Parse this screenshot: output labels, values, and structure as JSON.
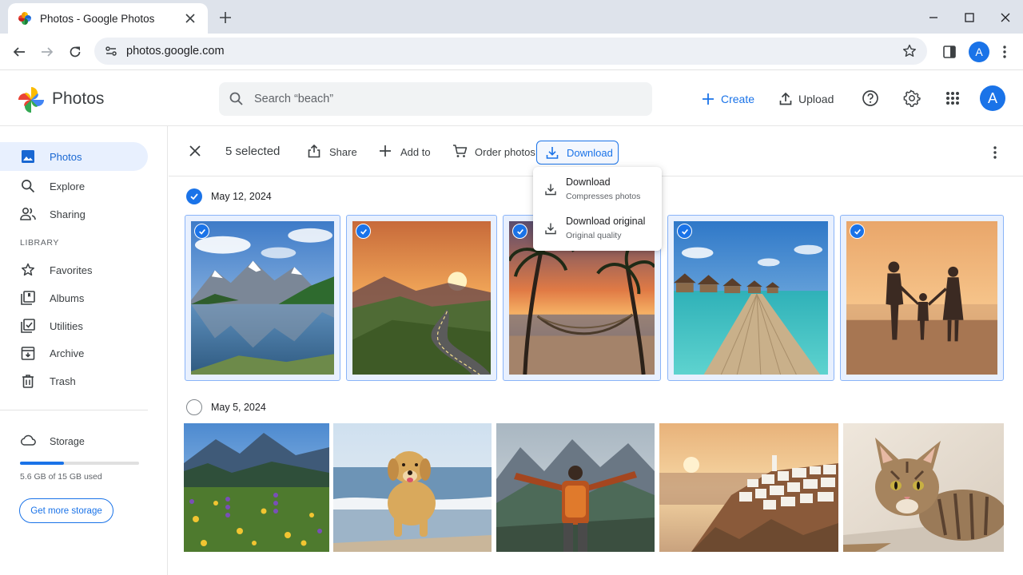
{
  "browser": {
    "tab_title": "Photos - Google Photos",
    "url": "photos.google.com",
    "profile_initial": "A"
  },
  "header": {
    "brand": "Photos",
    "search_placeholder": "Search “beach”",
    "create_label": "Create",
    "upload_label": "Upload",
    "avatar_initial": "A"
  },
  "sidebar": {
    "items": [
      {
        "label": "Photos",
        "icon": "photos-icon",
        "active": true
      },
      {
        "label": "Explore",
        "icon": "search-icon"
      },
      {
        "label": "Sharing",
        "icon": "people-icon"
      }
    ],
    "library_label": "LIBRARY",
    "library_items": [
      {
        "label": "Favorites",
        "icon": "star-icon"
      },
      {
        "label": "Albums",
        "icon": "albums-icon"
      },
      {
        "label": "Utilities",
        "icon": "utilities-icon"
      },
      {
        "label": "Archive",
        "icon": "archive-icon"
      },
      {
        "label": "Trash",
        "icon": "trash-icon"
      }
    ],
    "storage_label": "Storage",
    "storage_used_text": "5.6 GB of 15 GB used",
    "storage_fraction": 0.37,
    "get_more_label": "Get more storage"
  },
  "selection": {
    "count_text": "5 selected",
    "share_label": "Share",
    "add_to_label": "Add to",
    "order_label": "Order photos",
    "download_label": "Download"
  },
  "download_menu": [
    {
      "title": "Download",
      "subtitle": "Compresses photos"
    },
    {
      "title": "Download original",
      "subtitle": "Original quality"
    }
  ],
  "groups": [
    {
      "date": "May 12, 2024",
      "selected": true
    },
    {
      "date": "May 5, 2024",
      "selected": false
    }
  ],
  "colors": {
    "accent": "#1a73e8",
    "selected_bg": "#e8f0fe"
  }
}
